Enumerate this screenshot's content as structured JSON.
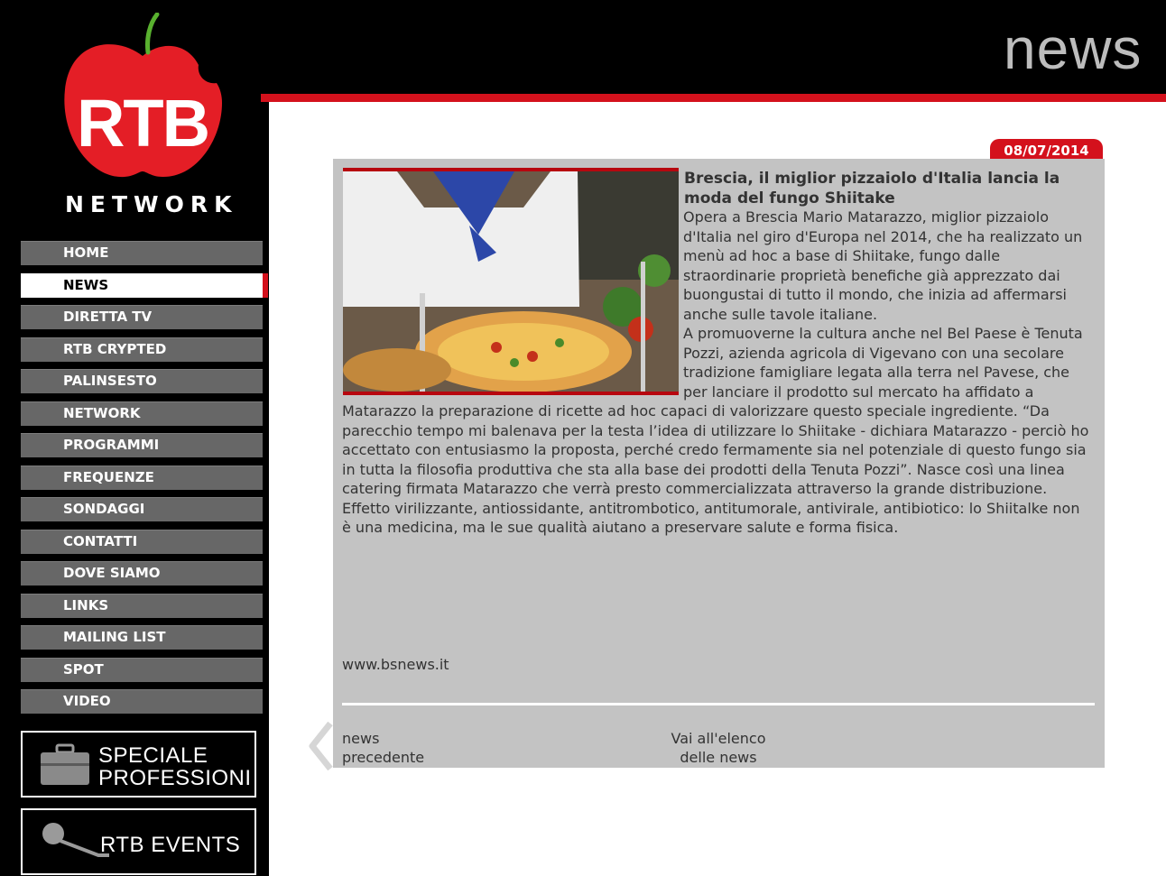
{
  "header": {
    "section_word": "news"
  },
  "logo": {
    "brand": "RTB",
    "subtitle": "NETWORK"
  },
  "nav": {
    "items": [
      {
        "label": "HOME"
      },
      {
        "label": "NEWS",
        "active": true
      },
      {
        "label": "DIRETTA TV"
      },
      {
        "label": "RTB CRYPTED"
      },
      {
        "label": "PALINSESTO"
      },
      {
        "label": "NETWORK"
      },
      {
        "label": "PROGRAMMI"
      },
      {
        "label": "FREQUENZE"
      },
      {
        "label": "SONDAGGI"
      },
      {
        "label": "CONTATTI"
      },
      {
        "label": "DOVE SIAMO"
      },
      {
        "label": "LINKS"
      },
      {
        "label": "MAILING LIST"
      },
      {
        "label": "SPOT"
      },
      {
        "label": "VIDEO"
      }
    ]
  },
  "promos": {
    "speciale_line1": "SPECIALE",
    "speciale_line2": "PROFESSIONI",
    "events": "RTB EVENTS"
  },
  "article": {
    "date": "08/07/2014",
    "title": "Brescia, il miglior pizzaiolo d'Italia lancia la moda del fungo Shiitake",
    "paragraph1": "Opera a Brescia Mario Matarazzo, miglior pizzaiolo d'Italia nel giro d'Europa nel 2014, che ha realizzato un menù ad hoc a base di Shiitake, fungo dalle straordinarie proprietà benefiche già apprezzato dai buongustai di tutto il mondo, che inizia ad affermarsi anche sulle tavole italiane.",
    "paragraph2": "A promuoverne la cultura anche nel Bel Paese è Tenuta Pozzi, azienda agricola di Vigevano con una secolare tradizione famigliare legata alla terra nel Pavese, che per lanciare il prodotto sul mercato ha affidato a Matarazzo la preparazione di ricette ad hoc capaci di valorizzare questo speciale ingrediente. “Da parecchio tempo mi balenava per la testa l’idea di utilizzare lo Shiitake - dichiara Matarazzo - perciò ho accettato con entusiasmo la proposta, perché credo fermamente sia nel potenziale di questo fungo sia in tutta la filosofia produttiva che sta alla base dei prodotti della Tenuta Pozzi”. Nasce così una linea catering firmata Matarazzo che verrà presto commercializzata attraverso la grande distribuzione.",
    "paragraph3": "Effetto virilizzante, antiossidante, antitrombotico, antitumorale, antivirale, antibiotico: lo Shiitalke non è una medicina, ma le sue qualità aiutano a preservare salute e forma fisica.",
    "source": "www.bsnews.it",
    "prev_line1": "news",
    "prev_line2": "precedente",
    "list_line1": "Vai all'elenco",
    "list_line2": "delle news"
  },
  "colors": {
    "accent_red": "#d4111c",
    "nav_gray": "#676767",
    "panel_gray": "#c3c3c3"
  },
  "icons": [
    "apple-logo-icon",
    "briefcase-icon",
    "microphone-icon",
    "chevron-left-icon"
  ]
}
